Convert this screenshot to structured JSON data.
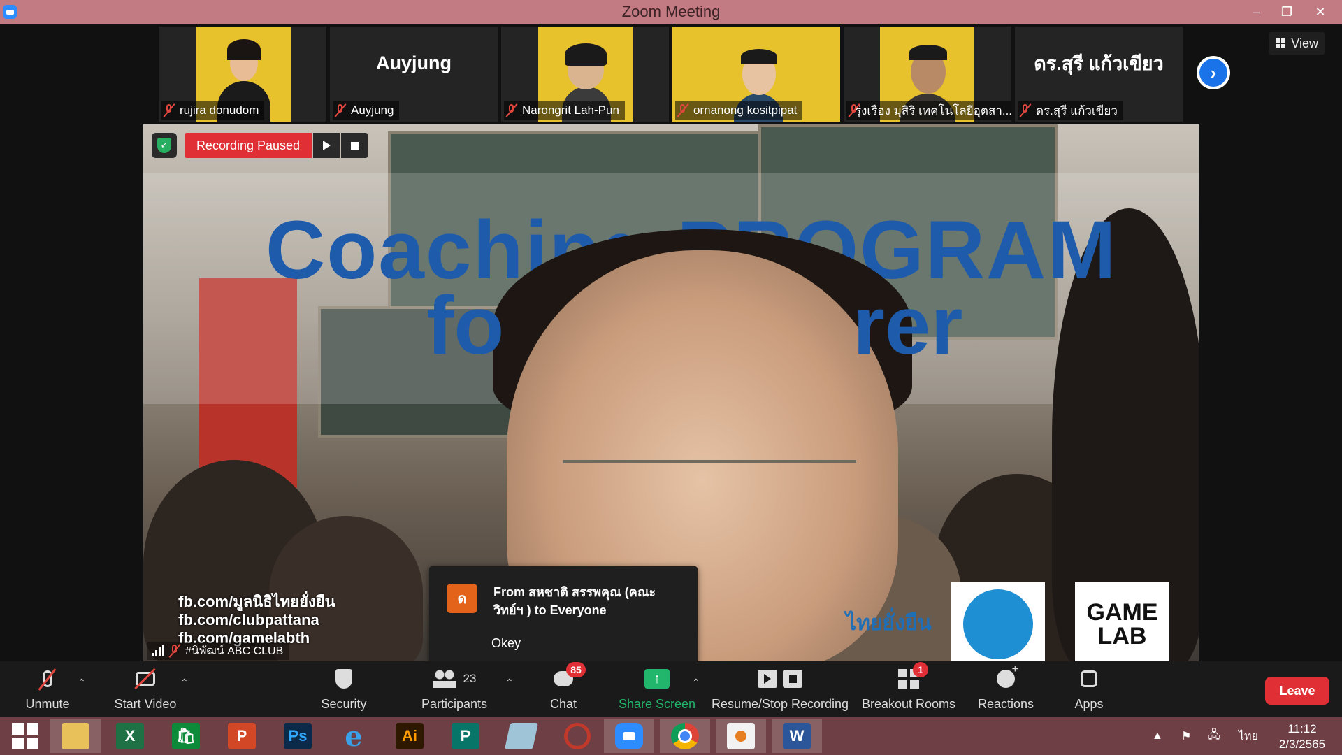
{
  "window": {
    "title": "Zoom Meeting",
    "minimize": "–",
    "maximize": "❐",
    "close": "✕"
  },
  "gallery": {
    "participants": [
      {
        "name": "rujira donudom",
        "display": "video"
      },
      {
        "name": "Auyjung",
        "display": "name",
        "big_name": "Auyjung"
      },
      {
        "name": "Narongrit Lah-Pun",
        "display": "video"
      },
      {
        "name": "ornanong kositpipat",
        "display": "video"
      },
      {
        "name": "รุ่งเรือง มุสิริ เทคโนโลยีอุตสา...",
        "display": "video"
      },
      {
        "name": "ดร.สุรี  แก้วเขียว",
        "display": "name",
        "big_name": "ดร.สุรี  แก้วเขียว"
      }
    ],
    "next_icon": "›",
    "view_label": "View"
  },
  "main_video": {
    "recording_status": "Recording Paused",
    "speaker_name": "#นิพัฒน์ ABC CLUB",
    "slide_title": "Coaching PROGRAM",
    "slide_subtitle_left": "fo",
    "slide_subtitle_right": "rer",
    "fb_lines": [
      "fb.com/มูลนิธิไทยยั่งยืน",
      "fb.com/clubpattana",
      "fb.com/gamelabth"
    ],
    "logo_thai": "ไทยยั่งยืน",
    "logo_gamelab": "GAME LAB"
  },
  "chat_popup": {
    "avatar_letter": "ด",
    "from": "From สหชาติ สรรพคุณ (คณะวิทย์ฯ ) to Everyone",
    "message": "Okey"
  },
  "toolbar": {
    "unmute": "Unmute",
    "start_video": "Start Video",
    "security": "Security",
    "participants": "Participants",
    "participants_count": "23",
    "chat": "Chat",
    "chat_badge": "85",
    "share_screen": "Share Screen",
    "resume_stop_recording": "Resume/Stop Recording",
    "breakout_rooms": "Breakout Rooms",
    "breakout_badge": "1",
    "reactions": "Reactions",
    "apps": "Apps",
    "leave": "Leave"
  },
  "taskbar": {
    "apps": [
      "File Explorer",
      "Excel",
      "Store",
      "PowerPoint",
      "Photoshop",
      "Internet Explorer",
      "Illustrator",
      "Publisher",
      "Notes",
      "PhotoScape",
      "Zoom",
      "Chrome",
      "Paint",
      "Word"
    ],
    "app_glyphs": {
      "excel": "X",
      "store": "🛍",
      "powerpoint": "P",
      "photoshop": "Ps",
      "ie": "e",
      "illustrator": "Ai",
      "publisher": "P",
      "word": "W"
    },
    "language": "ไทย",
    "time": "11:12",
    "date": "2/3/2565"
  },
  "colors": {
    "titlebar": "#c27b82",
    "taskbar": "#6e3f44",
    "recording_red": "#e02f35",
    "share_green": "#21b66b",
    "slide_blue": "#1f5bab"
  }
}
